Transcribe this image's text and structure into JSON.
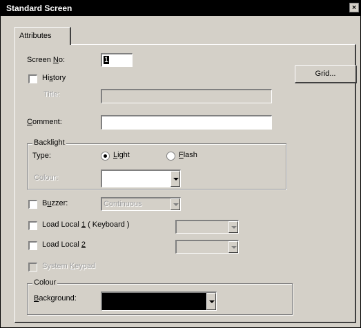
{
  "window": {
    "title": "Standard Screen",
    "close_glyph": "×"
  },
  "tab": {
    "label": "Attributes"
  },
  "screen_no": {
    "label": "Screen No:",
    "value": "1"
  },
  "history": {
    "label": "History",
    "checked": false
  },
  "title_field": {
    "label": "Title:",
    "value": ""
  },
  "grid_button": {
    "label": "Grid..."
  },
  "comment": {
    "label": "Comment:",
    "value": ""
  },
  "backlight": {
    "group_label": "Backlight",
    "type_label": "Type:",
    "light_label": "Light",
    "flash_label": "Flash",
    "selected": "Light",
    "colour_label": "Colour:",
    "colour_value": ""
  },
  "buzzer": {
    "label": "Buzzer:",
    "value": "Continuous",
    "checked": false
  },
  "load_local_1": {
    "label": "Load Local 1 ( Keyboard )",
    "value": "",
    "checked": false
  },
  "load_local_2": {
    "label": "Load Local 2",
    "value": "",
    "checked": false
  },
  "system_keypad": {
    "label": "System Keypad",
    "checked": false
  },
  "colour_group": {
    "group_label": "Colour",
    "background_label": "Background:",
    "background_value": "",
    "background_color": "#000000"
  }
}
